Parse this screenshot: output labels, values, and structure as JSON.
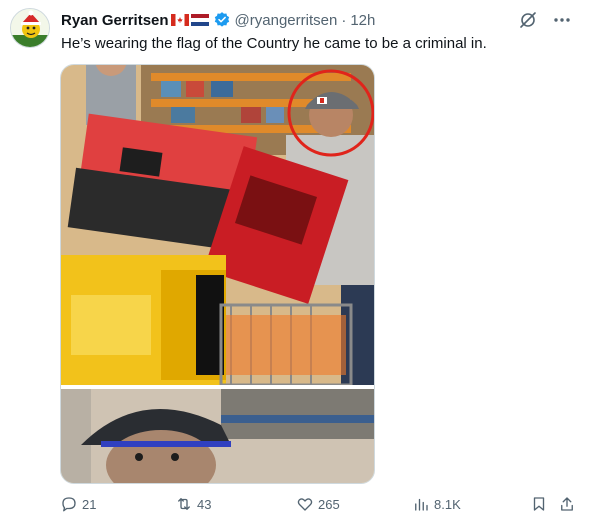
{
  "author": {
    "name": "Ryan Gerritsen",
    "handle": "@ryangerritsen",
    "dot": "·",
    "time": "12h",
    "flags": [
      "canada-flag-icon",
      "netherlands-flag-icon"
    ],
    "verified_icon": "verified-badge-icon"
  },
  "tweet": {
    "text": "He’s wearing the flag of the Country he came to be a criminal in."
  },
  "media": {
    "description_icon": "surveillance-photo"
  },
  "metrics": {
    "replies": "21",
    "retweets": "43",
    "likes": "265",
    "views": "8.1K"
  },
  "colors": {
    "brand_blue": "#1d9bf0",
    "text_secondary": "#536471",
    "highlight_circle": "#e0241b"
  }
}
